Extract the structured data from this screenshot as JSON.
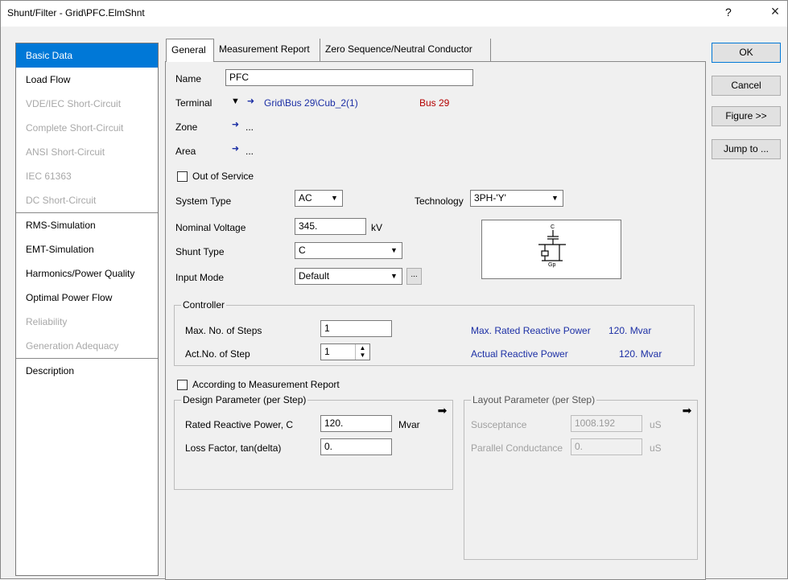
{
  "window": {
    "title": "Shunt/Filter - Grid\\PFC.ElmShnt",
    "help": "?",
    "close": "×"
  },
  "sidebar": {
    "items": [
      {
        "label": "Basic Data"
      },
      {
        "label": "Load Flow"
      },
      {
        "label": "VDE/IEC Short-Circuit"
      },
      {
        "label": "Complete Short-Circuit"
      },
      {
        "label": "ANSI Short-Circuit"
      },
      {
        "label": "IEC 61363"
      },
      {
        "label": "DC Short-Circuit"
      },
      {
        "label": "RMS-Simulation"
      },
      {
        "label": "EMT-Simulation"
      },
      {
        "label": "Harmonics/Power Quality"
      },
      {
        "label": "Optimal Power Flow"
      },
      {
        "label": "Reliability"
      },
      {
        "label": "Generation Adequacy"
      },
      {
        "label": "Description"
      }
    ]
  },
  "tabs": [
    {
      "label": "General"
    },
    {
      "label": "Measurement Report"
    },
    {
      "label": "Zero Sequence/Neutral Conductor"
    }
  ],
  "buttons": {
    "ok": "OK",
    "cancel": "Cancel",
    "figure": "Figure >>",
    "jump": "Jump to ..."
  },
  "general": {
    "name_label": "Name",
    "name_value": "PFC",
    "terminal_label": "Terminal",
    "terminal_value": "Grid\\Bus 29\\Cub_2(1)",
    "terminal_bus": "Bus 29",
    "zone_label": "Zone",
    "zone_dots": "...",
    "area_label": "Area",
    "area_dots": "...",
    "out_of_service_label": "Out of Service",
    "system_type_label": "System Type",
    "system_type_value": "AC",
    "technology_label": "Technology",
    "technology_value": "3PH-'Y'",
    "nominal_voltage_label": "Nominal Voltage",
    "nominal_voltage_value": "345.",
    "nominal_voltage_unit": "kV",
    "shunt_type_label": "Shunt Type",
    "shunt_type_value": "C",
    "input_mode_label": "Input Mode",
    "input_mode_value": "Default",
    "input_mode_button": "...",
    "figure_symbol_c": "C",
    "figure_symbol_gp": "Gp"
  },
  "controller": {
    "title": "Controller",
    "max_steps_label": "Max. No. of Steps",
    "max_steps_value": "1",
    "act_step_label": "Act.No. of Step",
    "act_step_value": "1",
    "max_rated_label": "Max. Rated Reactive Power",
    "max_rated_value": "120. Mvar",
    "actual_label": "Actual Reactive Power",
    "actual_value": "120. Mvar"
  },
  "measurement": {
    "according_label": "According to Measurement Report"
  },
  "design": {
    "title": "Design Parameter (per Step)",
    "rated_label": "Rated Reactive Power, C",
    "rated_value": "120.",
    "rated_unit": "Mvar",
    "loss_label": "Loss Factor, tan(delta)",
    "loss_value": "0."
  },
  "layout_param": {
    "title": "Layout Parameter (per Step)",
    "susceptance_label": "Susceptance",
    "susceptance_value": "1008.192",
    "susceptance_unit": "uS",
    "parallel_label": "Parallel Conductance",
    "parallel_value": "0.",
    "parallel_unit": "uS"
  }
}
